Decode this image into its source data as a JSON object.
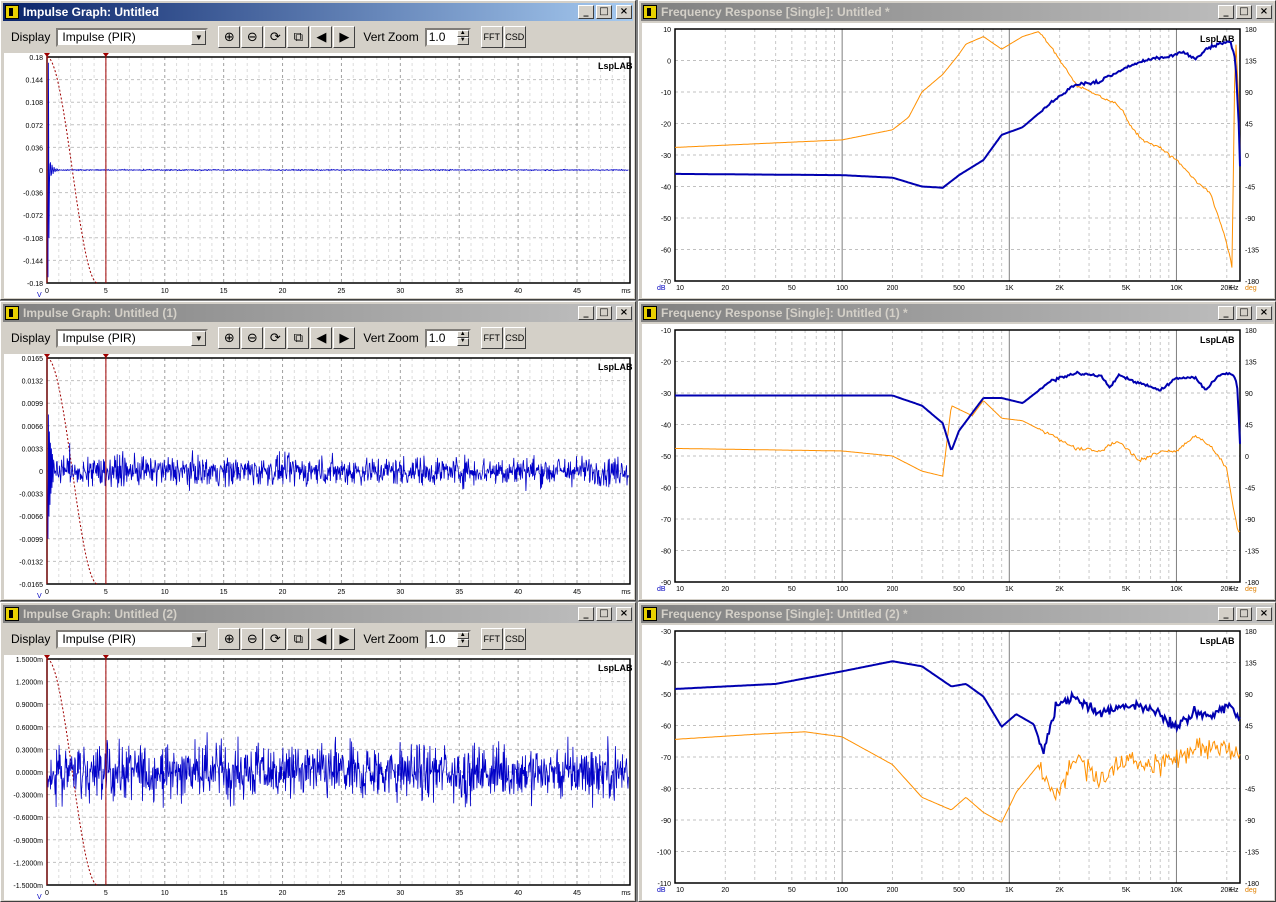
{
  "impulse_windows": [
    {
      "title": "Impulse Graph: Untitled",
      "display_label": "Display",
      "display_value": "Impulse (PIR)",
      "vert_zoom_label": "Vert Zoom",
      "vert_zoom_value": "1.0",
      "fft_label": "FFT",
      "csd_label": "CSD",
      "logo": "LspLAB",
      "y_ticks": [
        "0.18",
        "0.144",
        "0.108",
        "0.072",
        "0.036",
        "0",
        "-0.036",
        "-0.072",
        "-0.108",
        "-0.144",
        "-0.18"
      ],
      "x_ticks": [
        "0",
        "5",
        "10",
        "15",
        "20",
        "25",
        "30",
        "35",
        "40",
        "45",
        "ms"
      ],
      "y_unit": "V",
      "active": true
    },
    {
      "title": "Impulse Graph: Untitled (1)",
      "display_label": "Display",
      "display_value": "Impulse (PIR)",
      "vert_zoom_label": "Vert Zoom",
      "vert_zoom_value": "1.0",
      "fft_label": "FFT",
      "csd_label": "CSD",
      "logo": "LspLAB",
      "y_ticks": [
        "0.0165",
        "0.0132",
        "0.0099",
        "0.0066",
        "0.0033",
        "0",
        "-0.0033",
        "-0.0066",
        "-0.0099",
        "-0.0132",
        "-0.0165"
      ],
      "x_ticks": [
        "0",
        "5",
        "10",
        "15",
        "20",
        "25",
        "30",
        "35",
        "40",
        "45",
        "ms"
      ],
      "y_unit": "V",
      "active": false
    },
    {
      "title": "Impulse Graph: Untitled (2)",
      "display_label": "Display",
      "display_value": "Impulse (PIR)",
      "vert_zoom_label": "Vert Zoom",
      "vert_zoom_value": "1.0",
      "fft_label": "FFT",
      "csd_label": "CSD",
      "logo": "LspLAB",
      "y_ticks": [
        "1.5000m",
        "1.2000m",
        "0.9000m",
        "0.6000m",
        "0.3000m",
        "0.0000m",
        "-0.3000m",
        "-0.6000m",
        "-0.9000m",
        "-1.2000m",
        "-1.5000m"
      ],
      "x_ticks": [
        "0",
        "5",
        "10",
        "15",
        "20",
        "25",
        "30",
        "35",
        "40",
        "45",
        "ms"
      ],
      "y_unit": "V",
      "active": false
    }
  ],
  "freq_windows": [
    {
      "title": "Frequency Response [Single]: Untitled *",
      "logo": "LspLAB",
      "db_ticks": [
        "10",
        "0",
        "-10",
        "-20",
        "-30",
        "-40",
        "-50",
        "-60",
        "-70"
      ],
      "deg_ticks": [
        "180",
        "135",
        "90",
        "45",
        "0",
        "-45",
        "-90",
        "-135",
        "-180"
      ],
      "x_ticks": [
        "10",
        "20",
        "50",
        "100",
        "200",
        "500",
        "1K",
        "2K",
        "5K",
        "10K",
        "20K"
      ],
      "db_unit": "dB",
      "hz_unit": "Hz",
      "deg_unit": "deg"
    },
    {
      "title": "Frequency Response [Single]: Untitled (1) *",
      "logo": "LspLAB",
      "db_ticks": [
        "-10",
        "-20",
        "-30",
        "-40",
        "-50",
        "-60",
        "-70",
        "-80",
        "-90"
      ],
      "deg_ticks": [
        "180",
        "135",
        "90",
        "45",
        "0",
        "-45",
        "-90",
        "-135",
        "-180"
      ],
      "x_ticks": [
        "10",
        "20",
        "50",
        "100",
        "200",
        "500",
        "1K",
        "2K",
        "5K",
        "10K",
        "20K"
      ],
      "db_unit": "dB",
      "hz_unit": "Hz",
      "deg_unit": "deg"
    },
    {
      "title": "Frequency Response [Single]: Untitled (2) *",
      "logo": "LspLAB",
      "db_ticks": [
        "-30",
        "-40",
        "-50",
        "-60",
        "-70",
        "-80",
        "-90",
        "-100",
        "-110"
      ],
      "deg_ticks": [
        "180",
        "135",
        "90",
        "45",
        "0",
        "-45",
        "-90",
        "-135",
        "-180"
      ],
      "x_ticks": [
        "10",
        "20",
        "50",
        "100",
        "200",
        "500",
        "1K",
        "2K",
        "5K",
        "10K",
        "20K"
      ],
      "db_unit": "dB",
      "hz_unit": "Hz",
      "deg_unit": "deg"
    }
  ],
  "window_buttons": {
    "minimize": "_",
    "maximize": "□",
    "close": "×"
  },
  "colors": {
    "magnitude": "#0000b0",
    "phase": "#ff9000",
    "impulse": "#0000c8",
    "marker": "#a00000"
  }
}
